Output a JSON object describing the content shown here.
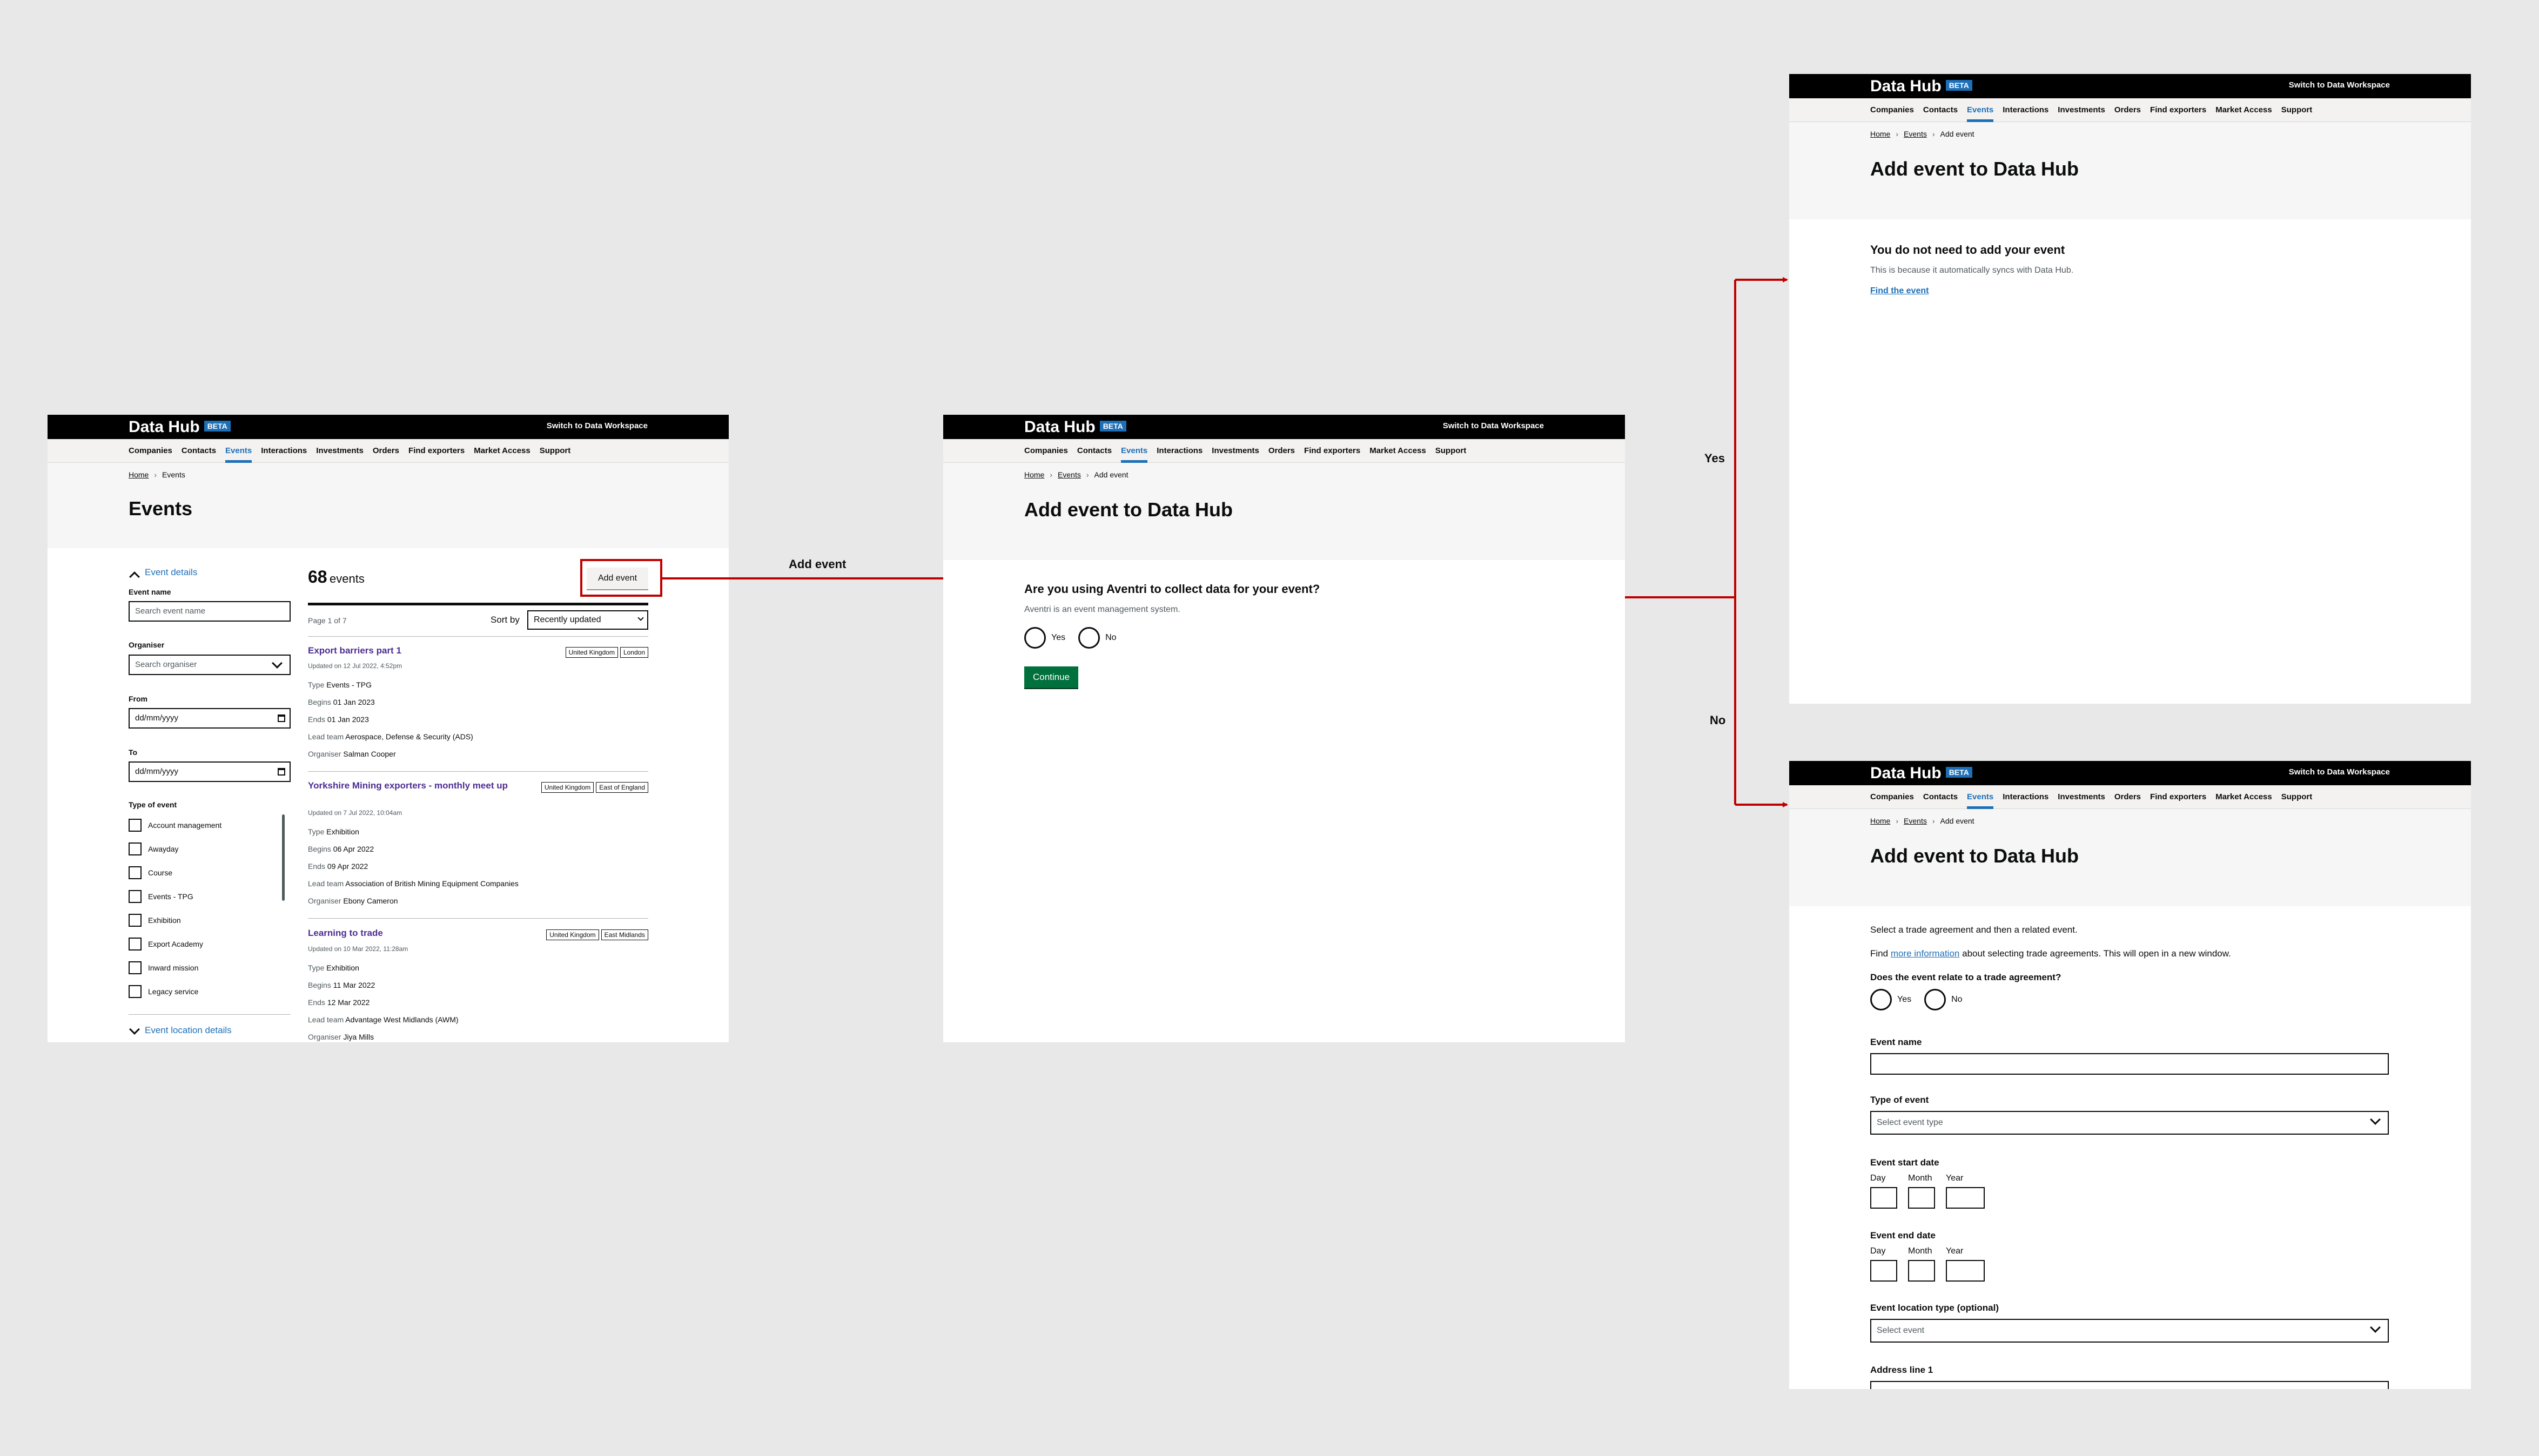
{
  "shared": {
    "brand": "Data Hub",
    "beta": "BETA",
    "switch": "Switch to Data Workspace",
    "nav": [
      "Companies",
      "Contacts",
      "Events",
      "Interactions",
      "Investments",
      "Orders",
      "Find exporters",
      "Market Access",
      "Support"
    ],
    "nav_active": "Events"
  },
  "flow": {
    "add_event": "Add event",
    "yes": "Yes",
    "no": "No",
    "highlight_color": "#c00000"
  },
  "screen1": {
    "breadcrumb": {
      "home": "Home",
      "current": "Events"
    },
    "title": "Events",
    "filters": {
      "section_event_details": "Event details",
      "event_name_label": "Event name",
      "event_name_placeholder": "Search event name",
      "organiser_label": "Organiser",
      "organiser_placeholder": "Search organiser",
      "from_label": "From",
      "from_placeholder": "dd/mm/yyyy",
      "to_label": "To",
      "to_placeholder": "dd/mm/yyyy",
      "type_label": "Type of event",
      "types": [
        "Account management",
        "Awayday",
        "Course",
        "Events - TPG",
        "Exhibition",
        "Export Academy",
        "Inward mission",
        "Legacy service"
      ],
      "section_location": "Event location details"
    },
    "results": {
      "count": "68",
      "count_label": "events",
      "add_button": "Add event",
      "page": "Page 1 of 7",
      "sort_label": "Sort by",
      "sort_value": "Recently updated",
      "items": [
        {
          "title": "Export barriers part 1",
          "updated": "Updated on 12 Jul 2022, 4:52pm",
          "tags": [
            "United Kingdom",
            "London"
          ],
          "type": "Events - TPG",
          "begins": "01 Jan 2023",
          "ends": "01 Jan 2023",
          "lead_team": "Aerospace, Defense & Security (ADS)",
          "organiser": "Salman Cooper"
        },
        {
          "title": "Yorkshire Mining exporters - monthly meet up",
          "updated": "Updated on 7 Jul 2022, 10:04am",
          "tags": [
            "United Kingdom",
            "East of England"
          ],
          "type": "Exhibition",
          "begins": "06 Apr 2022",
          "ends": "09 Apr 2022",
          "lead_team": "Association of British Mining Equipment Companies",
          "organiser": "Ebony Cameron"
        },
        {
          "title": "Learning to trade",
          "updated": "Updated on 10 Mar 2022, 11:28am",
          "tags": [
            "United Kingdom",
            "East Midlands"
          ],
          "type": "Exhibition",
          "begins": "11 Mar 2022",
          "ends": "12 Mar 2022",
          "lead_team": "Advantage West Midlands (AWM)",
          "organiser": "Jiya Mills"
        }
      ],
      "keys": {
        "type": "Type",
        "begins": "Begins",
        "ends": "Ends",
        "lead_team": "Lead team",
        "organiser": "Organiser"
      }
    }
  },
  "screen2": {
    "breadcrumb": {
      "home": "Home",
      "events": "Events",
      "current": "Add event"
    },
    "title": "Add event to Data Hub",
    "question": "Are you using Aventri to collect data for your event?",
    "hint": "Aventri is an event management system.",
    "yes": "Yes",
    "no": "No",
    "continue": "Continue"
  },
  "screen3": {
    "breadcrumb": {
      "home": "Home",
      "events": "Events",
      "current": "Add event"
    },
    "title": "Add event to Data Hub",
    "heading": "You do not need to add your event",
    "body": "This is because it automatically syncs with Data Hub.",
    "link": "Find the event"
  },
  "screen4": {
    "breadcrumb": {
      "home": "Home",
      "events": "Events",
      "current": "Add event"
    },
    "title": "Add event to Data Hub",
    "intro": "Select a trade agreement and then a related event.",
    "find_pre": "Find",
    "find_link": "more information",
    "find_post": "about selecting trade agreements. This will open in a new window.",
    "trade_question": "Does the event relate to a trade agreement?",
    "yes": "Yes",
    "no": "No",
    "event_name": "Event name",
    "type_label": "Type of event",
    "type_placeholder": "Select event type",
    "start_label": "Event start date",
    "end_label": "Event end date",
    "day": "Day",
    "month": "Month",
    "year": "Year",
    "location_label": "Event location type (optional)",
    "location_placeholder": "Select event",
    "address_label": "Address line 1"
  }
}
